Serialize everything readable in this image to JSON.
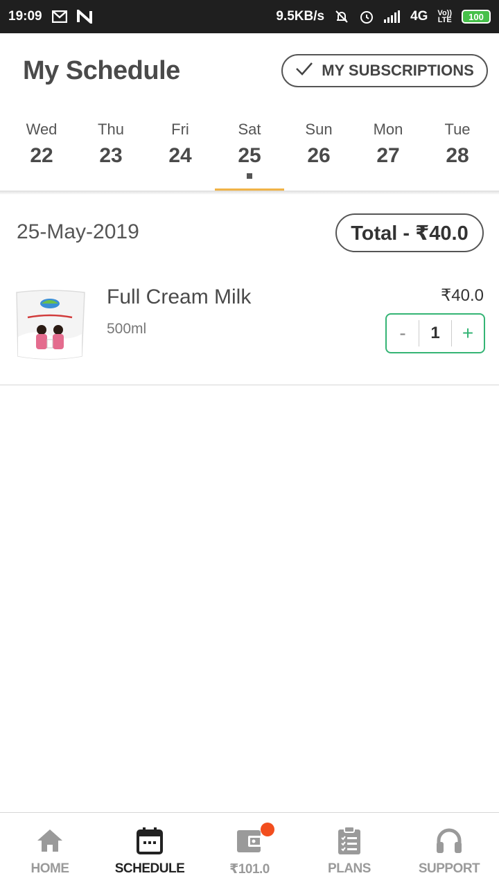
{
  "status_bar": {
    "time": "19:09",
    "net_speed": "9.5KB/s",
    "network": "4G",
    "lte_top": "Vo))",
    "lte_bottom": "LTE",
    "battery": "100"
  },
  "header": {
    "title": "My Schedule",
    "subscriptions_label": "MY SUBSCRIPTIONS"
  },
  "days": [
    {
      "name": "Wed",
      "num": "22"
    },
    {
      "name": "Thu",
      "num": "23"
    },
    {
      "name": "Fri",
      "num": "24"
    },
    {
      "name": "Sat",
      "num": "25"
    },
    {
      "name": "Sun",
      "num": "26"
    },
    {
      "name": "Mon",
      "num": "27"
    },
    {
      "name": "Tue",
      "num": "28"
    }
  ],
  "selected_day_index": 3,
  "schedule": {
    "date": "25-May-2019",
    "total": "Total - ₹40.0"
  },
  "product": {
    "name": "Full Cream Milk",
    "quantity_label": "500ml",
    "price": "₹40.0",
    "minus": "-",
    "count": "1",
    "plus": "+",
    "image_icon": "milk-pouch-image"
  },
  "nav": [
    {
      "label": "HOME",
      "icon": "home-icon"
    },
    {
      "label": "SCHEDULE",
      "icon": "calendar-icon"
    },
    {
      "label": "₹101.0",
      "icon": "wallet-icon"
    },
    {
      "label": "PLANS",
      "icon": "clipboard-icon"
    },
    {
      "label": "SUPPORT",
      "icon": "headphones-icon"
    }
  ],
  "active_nav_index": 1,
  "colors": {
    "accent_underline": "#f0b347",
    "stepper_green": "#34b474",
    "badge_red": "#f24e1e",
    "battery_green": "#46c04a"
  }
}
